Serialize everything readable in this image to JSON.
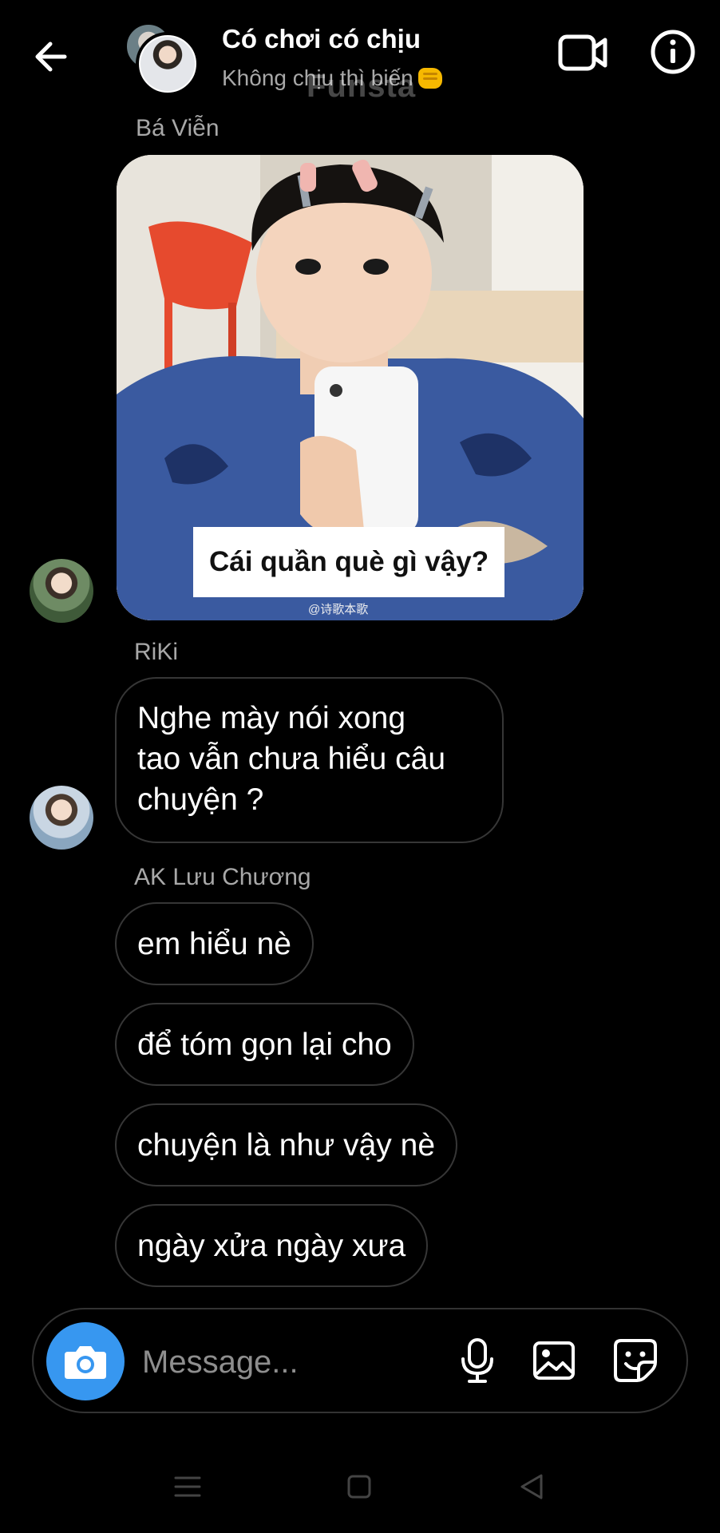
{
  "header": {
    "title": "Có chơi có chịu",
    "subtitle": "Không chịu thì biến",
    "subtitle_emoji": "oncoming-fist-icon",
    "watermark": "Funsta"
  },
  "messages": [
    {
      "sender": "Bá Viễn",
      "type": "image",
      "caption": "Cái quần què gì vậy?",
      "credit": "@诗歌本歌"
    },
    {
      "sender": "RiKi",
      "type": "text",
      "text": "Nghe mày nói xong\ntao vẫn chưa hiểu câu\nchuyện ?"
    },
    {
      "sender": "AK Lưu Chương",
      "type": "text-group",
      "texts": [
        "em hiểu nè",
        "để tóm gọn lại cho",
        "chuyện là như vậy nè",
        "ngày xửa ngày xưa"
      ]
    }
  ],
  "composer": {
    "placeholder": "Message..."
  },
  "colors": {
    "background": "#000000",
    "accent": "#3797f0",
    "secondary_text": "#a8a8a8",
    "bubble_border": "#363636"
  },
  "icons": {
    "back": "arrow-left-icon",
    "video": "video-camera-icon",
    "info": "info-icon",
    "camera": "camera-icon",
    "mic": "microphone-icon",
    "gallery": "image-icon",
    "sticker": "sticker-icon",
    "nav_menu": "menu-icon",
    "nav_home": "home-square-icon",
    "nav_back": "triangle-back-icon"
  }
}
